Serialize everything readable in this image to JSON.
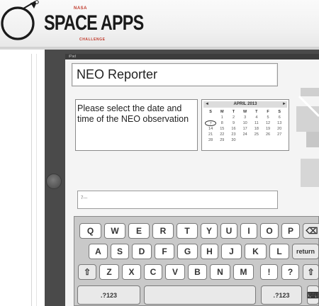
{
  "banner": {
    "logo_agency": "NASA",
    "logo_title": "SPACE APPS",
    "logo_subtitle": "CHALLENGE"
  },
  "status_bar": {
    "label": "iPad"
  },
  "app": {
    "title": "NEO Reporter",
    "instruction": "Please select the date and time of the NEO observation",
    "input_value": "7---"
  },
  "calendar": {
    "prev": "◄",
    "next": "►",
    "month": "APRIL 2013",
    "weekdays": [
      "S",
      "M",
      "T",
      "W",
      "T",
      "F",
      "S"
    ],
    "weeks": [
      [
        "",
        "1",
        "2",
        "3",
        "4",
        "5",
        "6"
      ],
      [
        "7",
        "8",
        "9",
        "10",
        "11",
        "12",
        "13"
      ],
      [
        "14",
        "15",
        "16",
        "17",
        "18",
        "19",
        "20"
      ],
      [
        "21",
        "22",
        "23",
        "24",
        "25",
        "26",
        "27"
      ],
      [
        "28",
        "29",
        "30",
        "",
        "",
        "",
        ""
      ]
    ],
    "selected_day": "7"
  },
  "keyboard": {
    "row1": [
      "Q",
      "W",
      "E",
      "R",
      "T",
      "Y",
      "U",
      "I",
      "O",
      "P",
      "⌫"
    ],
    "row2": [
      "A",
      "S",
      "D",
      "F",
      "G",
      "H",
      "J",
      "K",
      "L",
      "return"
    ],
    "row3": [
      "⇧",
      "Z",
      "X",
      "C",
      "V",
      "B",
      "N",
      "M",
      "!",
      "?",
      "⇧"
    ],
    "row4": [
      ".?123",
      "",
      ".?123",
      "⌨"
    ]
  },
  "colors": {
    "device_frame": "#4a4a4a",
    "keyboard_bg": "#c9c9c9",
    "brand_red": "#c0392b"
  }
}
